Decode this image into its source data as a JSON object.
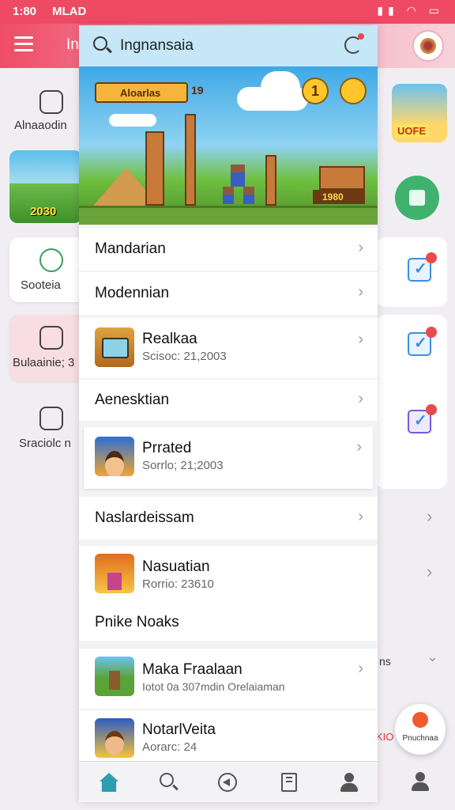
{
  "status_bar": {
    "time": "1:80",
    "carrier": "MLAD"
  },
  "background": {
    "app_title": "In",
    "left_cards": [
      {
        "label": "Alnaaodin"
      },
      {
        "label": "Sooteia"
      },
      {
        "label": "Bulaainie; 3"
      },
      {
        "label": "Sraciolc n"
      }
    ],
    "left_thumb_score": "2030",
    "right_thumb_text": "UOFE",
    "fab_label": "Pnuchnaa",
    "red_text": "KIO",
    "right_fragment": "ns"
  },
  "search": {
    "value": "Ingnansaia"
  },
  "banner": {
    "hud_label": "Aloarlas",
    "hud_value": "19",
    "coin_value": "1",
    "score": "1980"
  },
  "rows": [
    {
      "title": "Mandarian"
    },
    {
      "title": "Modennian"
    },
    {
      "title": "Realkaa",
      "subtitle": "Scisoc: 21,2003"
    },
    {
      "title": "Aenesktian"
    },
    {
      "title": "Prrated",
      "subtitle": "Sorrlo; 21;2003"
    },
    {
      "title": "Naslardeissam"
    },
    {
      "title": "Nasuatian",
      "subtitle": "Rorrio: 23610"
    },
    {
      "title": "Pnike Noaks"
    },
    {
      "title": "Maka Fraalaan",
      "subtitle": "Iotot 0a 307mdin Orelaiaman"
    },
    {
      "title": "NotarlVeita",
      "subtitle": "Aorarc: 24"
    }
  ],
  "colors": {
    "accent": "#ee4a64",
    "search_bg": "#c5e7f7",
    "nav_active": "#2d9db0"
  },
  "nav_icons": [
    "home-icon",
    "search-icon",
    "compass-icon",
    "book-icon",
    "profile-icon",
    "account-icon"
  ]
}
